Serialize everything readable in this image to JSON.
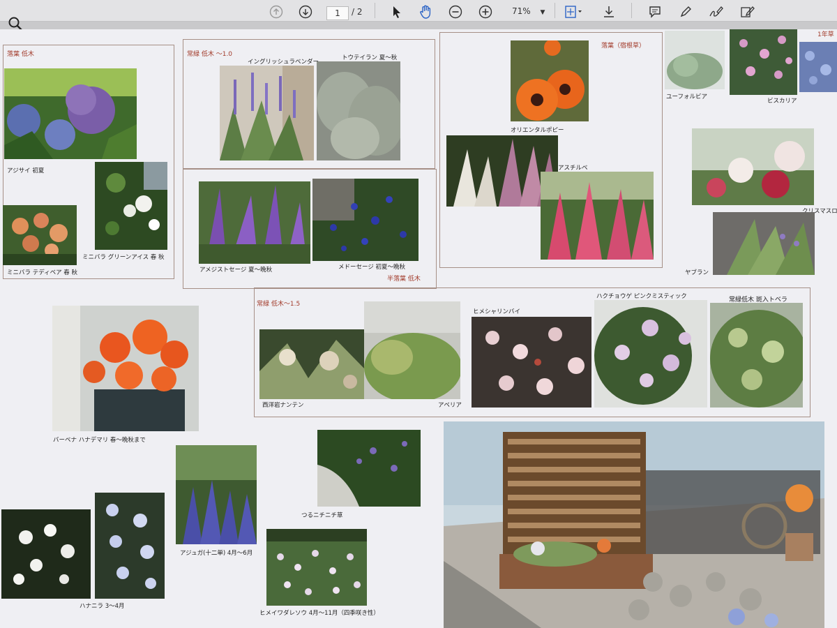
{
  "toolbar": {
    "page_current": "1",
    "page_total": "/ 2",
    "zoom": "71%",
    "icons": [
      "up-arrow-icon",
      "down-arrow-icon",
      "pointer-icon",
      "hand-icon",
      "zoom-out-icon",
      "zoom-in-icon",
      "fit-page-icon",
      "download-icon",
      "comment-icon",
      "pen-icon",
      "sign-icon",
      "edit-icon",
      "search-icon"
    ]
  },
  "groups": {
    "deciduous_shrub": "落葉 低木",
    "evergreen_shrub_1": "常緑 低木 ～1.0",
    "semi_deciduous": "半落葉 低木",
    "deciduous_perennial": "落葉（宿根草）",
    "evergreen_shrub_2": "常緑 低木～1.5",
    "annual": "1年草",
    "evergreen_tobira": "常緑低木 斑入トベラ"
  },
  "captions": {
    "ajisai": "アジサイ 初夏",
    "minibara_teddy": "ミニバラ テディベア  春 秋",
    "minibara_green": "ミニバラ グリーンアイス 春 秋",
    "lavender": "イングリッシュラベンダー",
    "touteiran": "トウテイラン 夏～秋",
    "amethyst": "アメジストセージ 夏～晩秋",
    "meadow": "メドーセージ 初夏～晩秋",
    "poppy": "オリエンタルポピー",
    "astilbe": "アスチルベ",
    "euphorbia": "ユーフォルビア",
    "viscaria": "ビスカリア",
    "christmas_rose": "クリスマスロ",
    "yaburan": "ヤブラン",
    "verbena": "バーベナ ハナデマリ 春～晩秋まで",
    "nandina": "西洋岩ナンテン",
    "abelia": "アベリア",
    "himesharinbai": "ヒメシャリンバイ",
    "hakuchouge": "ハクチョウゲ ピンクミスティック",
    "tsurunichinichi": "つるニチニチ草",
    "ajuga": "アジュガ(十二単) 4月～6月",
    "hananira": "ハナニラ 3～4月",
    "himeiwadaso": "ヒメイワダレソウ 4月～11月（四季咲き性）"
  }
}
